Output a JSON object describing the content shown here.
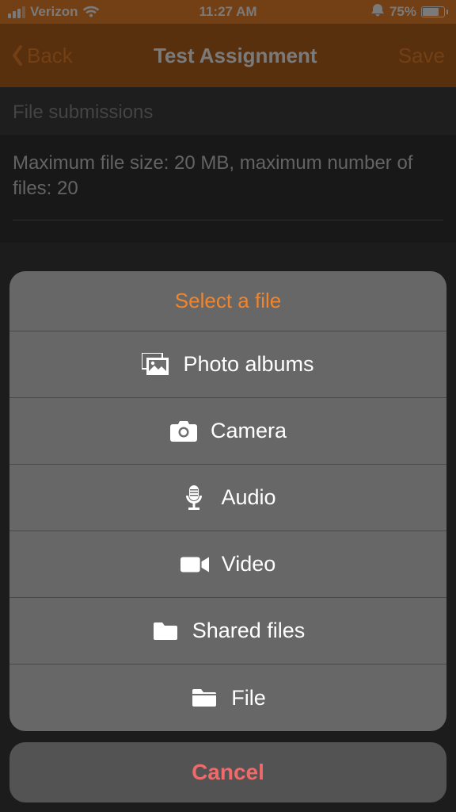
{
  "status": {
    "carrier": "Verizon",
    "time": "11:27 AM",
    "battery_pct": "75%"
  },
  "nav": {
    "back_label": "Back",
    "title": "Test Assignment",
    "save_label": "Save"
  },
  "page": {
    "section_title": "File submissions",
    "limits_text": "Maximum file size: 20 MB, maximum number of files: 20"
  },
  "sheet": {
    "title": "Select a file",
    "options": {
      "0": {
        "label": "Photo albums",
        "icon": "photo-albums-icon"
      },
      "1": {
        "label": "Camera",
        "icon": "camera-icon"
      },
      "2": {
        "label": "Audio",
        "icon": "audio-icon"
      },
      "3": {
        "label": "Video",
        "icon": "video-icon"
      },
      "4": {
        "label": "Shared files",
        "icon": "shared-files-icon"
      },
      "5": {
        "label": "File",
        "icon": "file-icon"
      }
    },
    "cancel_label": "Cancel"
  },
  "colors": {
    "accent": "#f0852c",
    "nav_bg": "#b8641c",
    "danger": "#ef6a6a"
  }
}
